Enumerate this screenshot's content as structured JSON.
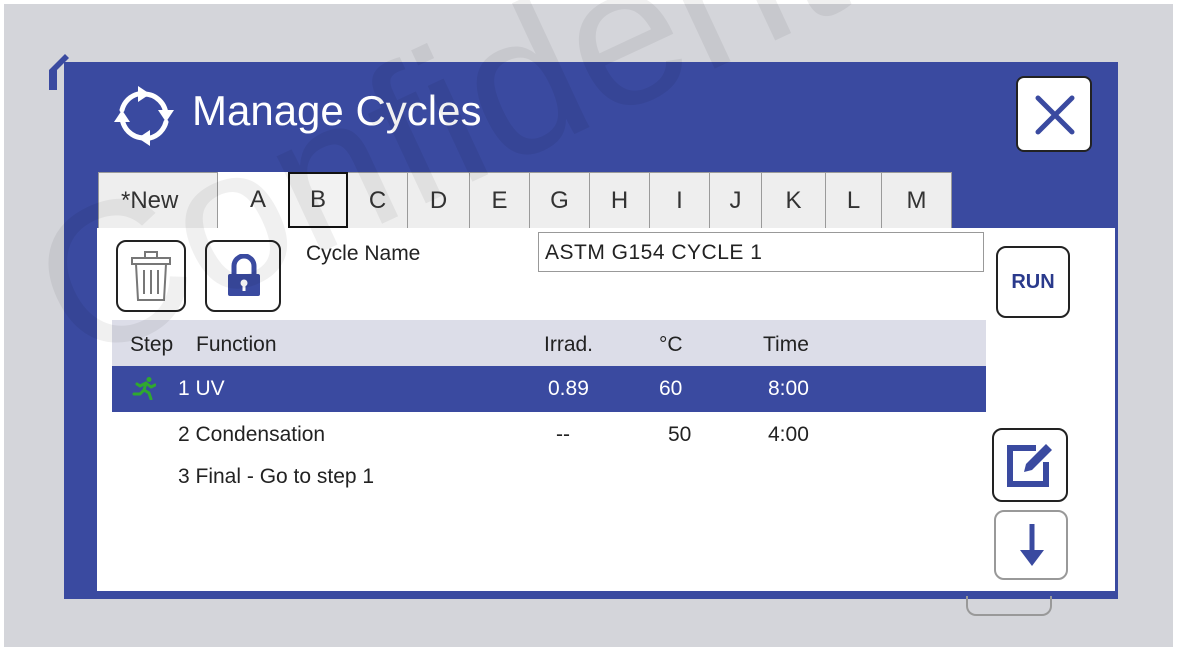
{
  "window": {
    "title": "Manage Cycles",
    "title_icon": "cycle-arrows-icon",
    "close_icon": "close-icon"
  },
  "tabs": [
    {
      "label": "*New"
    },
    {
      "label": "A",
      "active": true
    },
    {
      "label": "B",
      "focused": true
    },
    {
      "label": "C"
    },
    {
      "label": "D"
    },
    {
      "label": "E"
    },
    {
      "label": "G"
    },
    {
      "label": "H"
    },
    {
      "label": "I"
    },
    {
      "label": "J"
    },
    {
      "label": "K"
    },
    {
      "label": "L"
    },
    {
      "label": "M"
    }
  ],
  "toolbar": {
    "delete_icon": "trash-icon",
    "lock_icon": "lock-icon",
    "run_label": "RUN"
  },
  "cycle": {
    "name_label": "Cycle Name",
    "name_value": "ASTM G154 CYCLE 1"
  },
  "table": {
    "headers": {
      "step": "Step",
      "function": "Function",
      "irrad": "Irrad.",
      "temp": "°C",
      "time": "Time"
    },
    "rows": [
      {
        "step": "1 UV",
        "irrad": "0.89",
        "temp": "60",
        "time": "8:00",
        "running": true
      },
      {
        "step": "2 Condensation",
        "irrad": "--",
        "temp": "50",
        "time": "4:00"
      },
      {
        "step": "3 Final - Go to step 1",
        "irrad": "",
        "temp": "",
        "time": ""
      }
    ]
  },
  "side_buttons": {
    "edit_icon": "edit-icon",
    "down_icon": "arrow-down-icon"
  },
  "watermark": "Confidential",
  "colors": {
    "dialog_blue": "#3a4aa0",
    "header_row": "#dcdde8",
    "run_text": "#2a3a8c",
    "runner_green": "#2fa82f"
  }
}
